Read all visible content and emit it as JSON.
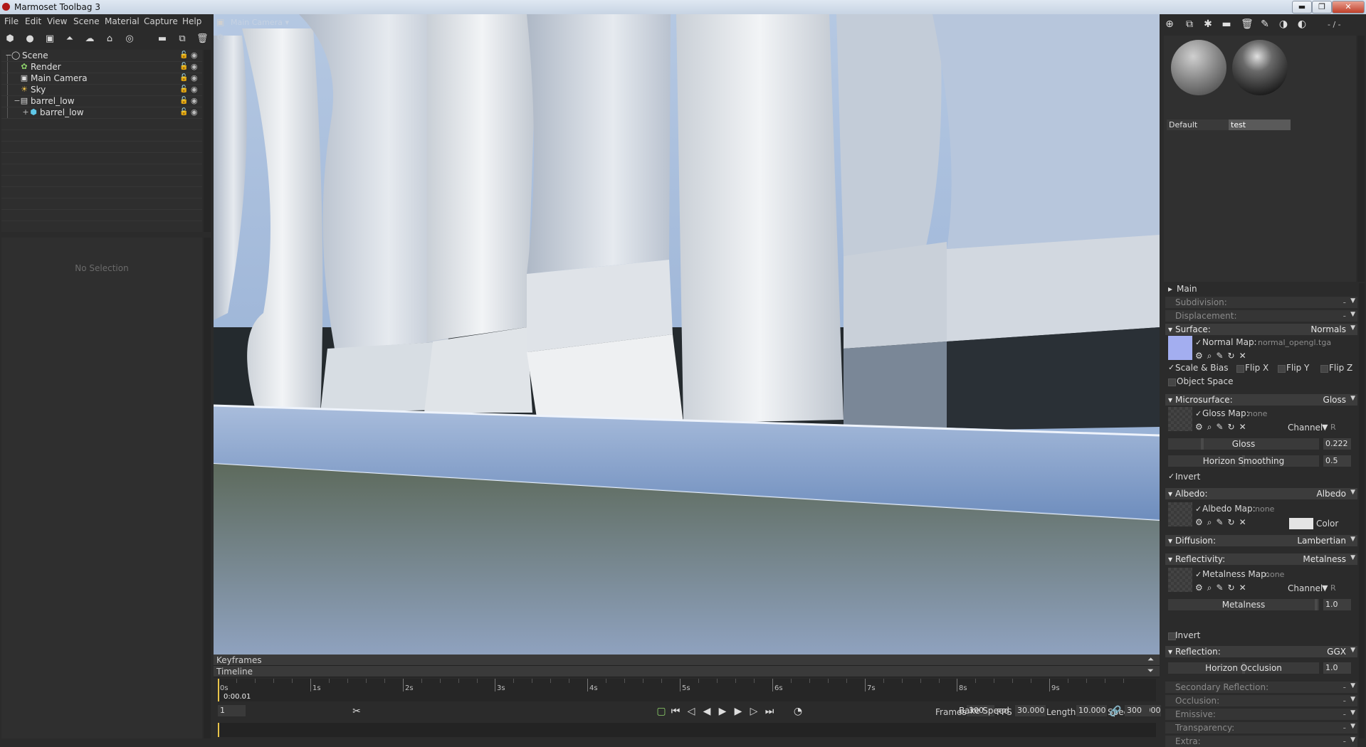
{
  "window": {
    "title": "Marmoset Toolbag 3",
    "minimize": "▬",
    "maximize": "❐",
    "close": "✕"
  },
  "menu": [
    "File",
    "Edit",
    "View",
    "Scene",
    "Material",
    "Capture",
    "Help"
  ],
  "scene_tree": {
    "items": [
      {
        "label": "Scene",
        "icon": "scene-icon"
      },
      {
        "label": "Render",
        "icon": "render-icon"
      },
      {
        "label": "Main Camera",
        "icon": "camera-icon"
      },
      {
        "label": "Sky",
        "icon": "sky-icon"
      },
      {
        "label": "barrel_low",
        "icon": "model-icon"
      },
      {
        "label": "barrel_low",
        "icon": "mesh-icon"
      }
    ],
    "no_selection": "No Selection"
  },
  "viewport": {
    "camera": "Main Camera"
  },
  "timeline": {
    "keyframes_label": "Keyframes",
    "timeline_label": "Timeline",
    "ticks": [
      "0s",
      "1s",
      "2s",
      "3s",
      "4s",
      "5s",
      "6s",
      "7s",
      "8s",
      "9s"
    ],
    "current_time": "0:00.01",
    "current_frame": "1",
    "frames_label": "Frames",
    "frames": "300",
    "fps_label": "FPS",
    "fps": "30.000",
    "length_label": "Length",
    "length": "10.000",
    "speed_label": "Speed",
    "speed": "1.000",
    "bake_speed": "Bake Speed",
    "link_frames": "300",
    "total_seconds": 10
  },
  "materials": {
    "count": "- / -",
    "items": [
      {
        "name": "Default"
      },
      {
        "name": "test"
      }
    ]
  },
  "material_props": {
    "main": "Main",
    "subdivision": {
      "label": "Subdivision:",
      "value": "-"
    },
    "displacement": {
      "label": "Displacement:",
      "value": "-"
    },
    "surface": {
      "label": "Surface:",
      "value": "Normals",
      "map_label": "Normal Map:",
      "map_value": "normal_opengl.tga",
      "scale_bias": "Scale & Bias",
      "flip_x": "Flip X",
      "flip_y": "Flip Y",
      "flip_z": "Flip Z",
      "object_space": "Object Space"
    },
    "microsurface": {
      "label": "Microsurface:",
      "value": "Gloss",
      "map_label": "Gloss Map:",
      "map_value": "none",
      "channel_label": "Channel",
      "channel": "R",
      "gloss_label": "Gloss",
      "gloss": "0.222",
      "gloss_fraction": 0.222,
      "horizon_label": "Horizon Smoothing",
      "horizon": "0.5",
      "invert": "Invert"
    },
    "albedo": {
      "label": "Albedo:",
      "value": "Albedo",
      "map_label": "Albedo Map:",
      "map_value": "none",
      "color_label": "Color",
      "color": "#e4e4e4"
    },
    "diffusion": {
      "label": "Diffusion:",
      "value": "Lambertian"
    },
    "reflectivity": {
      "label": "Reflectivity:",
      "value": "Metalness",
      "map_label": "Metalness Map:",
      "map_value": "none",
      "channel_label": "Channel",
      "channel": "R",
      "metalness_label": "Metalness",
      "metalness": "1.0",
      "invert": "Invert"
    },
    "reflection": {
      "label": "Reflection:",
      "value": "GGX",
      "horizon_label": "Horizon Occlusion",
      "horizon": "1.0"
    },
    "secondary": {
      "label": "Secondary Reflection:",
      "value": "-"
    },
    "occlusion": {
      "label": "Occlusion:",
      "value": "-"
    },
    "emissive": {
      "label": "Emissive:",
      "value": "-"
    },
    "transparency": {
      "label": "Transparency:",
      "value": "-"
    },
    "extra": {
      "label": "Extra:",
      "value": "-"
    }
  },
  "colors": {
    "accent": "#e8c34a",
    "viewport_sky": "#9fb6d6",
    "normal_thumb": "#a3aef0"
  }
}
